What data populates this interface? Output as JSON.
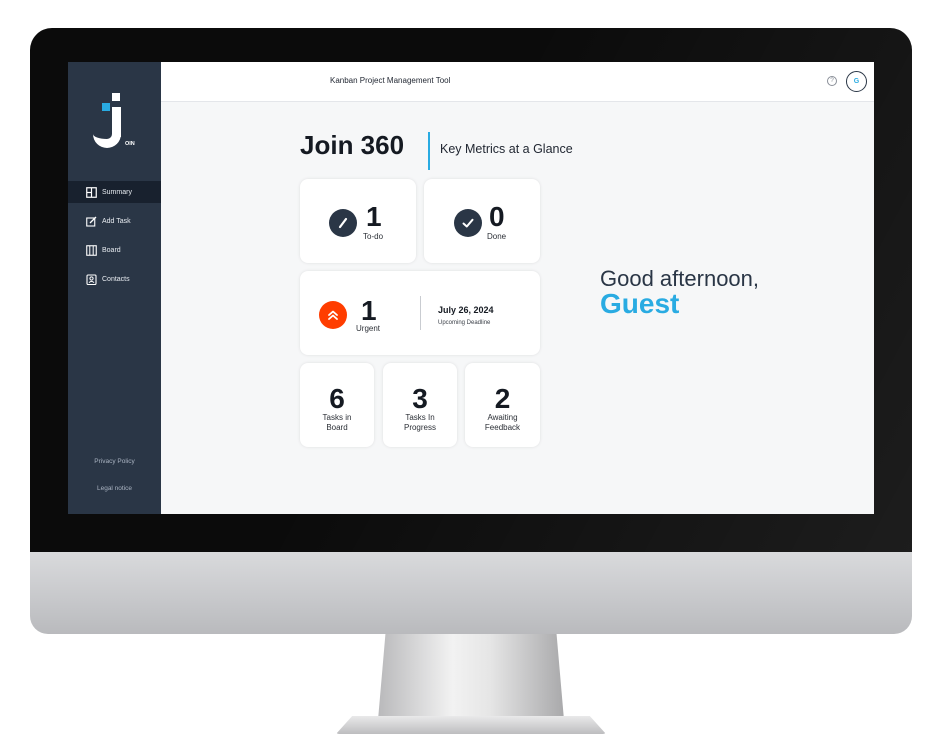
{
  "header": {
    "title": "Kanban Project Management Tool",
    "help_icon": "?",
    "avatar_initial": "G"
  },
  "logo": {
    "suffix": "OIN"
  },
  "sidebar": {
    "items": [
      {
        "label": "Summary",
        "icon": "summary-icon",
        "active": true
      },
      {
        "label": "Add Task",
        "icon": "edit-icon"
      },
      {
        "label": "Board",
        "icon": "board-icon"
      },
      {
        "label": "Contacts",
        "icon": "contacts-icon"
      }
    ],
    "footer": {
      "privacy": "Privacy Policy",
      "legal": "Legal notice"
    }
  },
  "main": {
    "title": "Join 360",
    "subtitle": "Key Metrics at a Glance",
    "todo": {
      "count": "1",
      "label": "To-do"
    },
    "done": {
      "count": "0",
      "label": "Done"
    },
    "urgent": {
      "count": "1",
      "label": "Urgent",
      "deadline_date": "July 26, 2024",
      "deadline_label": "Upcoming Deadline"
    },
    "stats": [
      {
        "count": "6",
        "label_1": "Tasks in",
        "label_2": "Board"
      },
      {
        "count": "3",
        "label_1": "Tasks In",
        "label_2": "Progress"
      },
      {
        "count": "2",
        "label_1": "Awaiting",
        "label_2": "Feedback"
      }
    ],
    "greeting": "Good afternoon,",
    "user_name": "Guest"
  },
  "colors": {
    "accent": "#29abe2",
    "sidebar": "#2a3646",
    "urgent": "#ff3d00"
  }
}
